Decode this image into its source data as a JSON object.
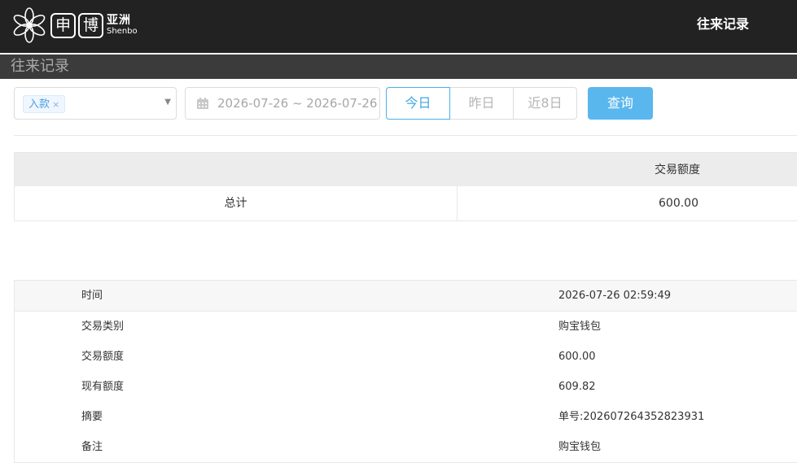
{
  "header": {
    "logo_char_1": "申",
    "logo_char_2": "博",
    "logo_cn": "亚洲",
    "logo_en": "Shenbo",
    "title": "往来记录"
  },
  "subheader": {
    "title": "往来记录"
  },
  "filters": {
    "type_tag": "入款",
    "tag_close": "×",
    "date_range": "2026-07-26 ~ 2026-07-26",
    "quick_ranges": [
      "今日",
      "昨日",
      "近8日"
    ],
    "active_range": "今日",
    "query_label": "查询"
  },
  "summary": {
    "column_header": "交易额度",
    "row_label": "总计",
    "row_value": "600.00"
  },
  "detail": {
    "rows": [
      {
        "label": "时间",
        "value": "2026-07-26 02:59:49"
      },
      {
        "label": "交易类别",
        "value": "购宝钱包"
      },
      {
        "label": "交易额度",
        "value": "600.00"
      },
      {
        "label": "现有额度",
        "value": "609.82"
      },
      {
        "label": "摘要",
        "value": "单号:202607264352823931"
      },
      {
        "label": "备注",
        "value": "购宝钱包"
      }
    ]
  },
  "colors": {
    "topbar": "#222222",
    "accent": "#5ab7ee",
    "active_border": "#4ab0e8"
  }
}
